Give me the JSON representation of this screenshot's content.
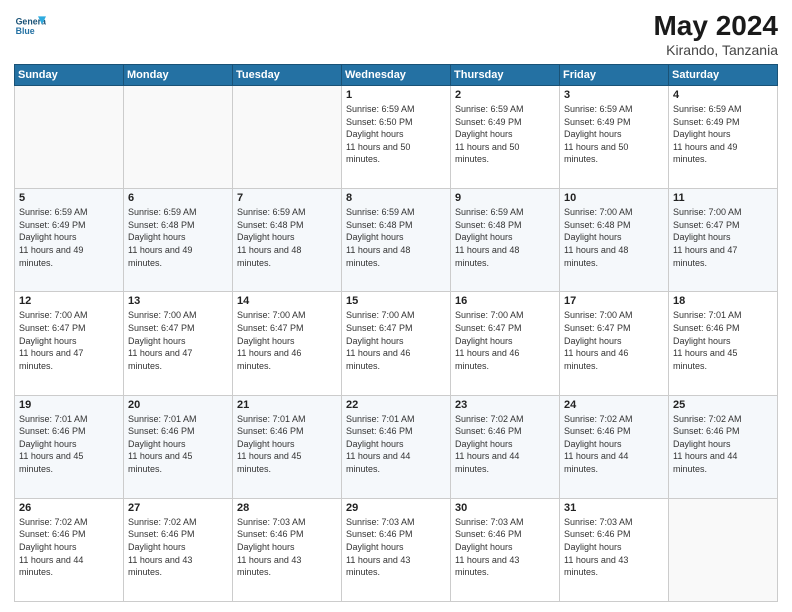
{
  "header": {
    "logo_line1": "General",
    "logo_line2": "Blue",
    "month": "May 2024",
    "location": "Kirando, Tanzania"
  },
  "weekdays": [
    "Sunday",
    "Monday",
    "Tuesday",
    "Wednesday",
    "Thursday",
    "Friday",
    "Saturday"
  ],
  "weeks": [
    [
      {
        "day": "",
        "sunrise": "",
        "sunset": "",
        "daylight": ""
      },
      {
        "day": "",
        "sunrise": "",
        "sunset": "",
        "daylight": ""
      },
      {
        "day": "",
        "sunrise": "",
        "sunset": "",
        "daylight": ""
      },
      {
        "day": "1",
        "sunrise": "6:59 AM",
        "sunset": "6:50 PM",
        "daylight": "11 hours and 50 minutes."
      },
      {
        "day": "2",
        "sunrise": "6:59 AM",
        "sunset": "6:49 PM",
        "daylight": "11 hours and 50 minutes."
      },
      {
        "day": "3",
        "sunrise": "6:59 AM",
        "sunset": "6:49 PM",
        "daylight": "11 hours and 50 minutes."
      },
      {
        "day": "4",
        "sunrise": "6:59 AM",
        "sunset": "6:49 PM",
        "daylight": "11 hours and 49 minutes."
      }
    ],
    [
      {
        "day": "5",
        "sunrise": "6:59 AM",
        "sunset": "6:49 PM",
        "daylight": "11 hours and 49 minutes."
      },
      {
        "day": "6",
        "sunrise": "6:59 AM",
        "sunset": "6:48 PM",
        "daylight": "11 hours and 49 minutes."
      },
      {
        "day": "7",
        "sunrise": "6:59 AM",
        "sunset": "6:48 PM",
        "daylight": "11 hours and 48 minutes."
      },
      {
        "day": "8",
        "sunrise": "6:59 AM",
        "sunset": "6:48 PM",
        "daylight": "11 hours and 48 minutes."
      },
      {
        "day": "9",
        "sunrise": "6:59 AM",
        "sunset": "6:48 PM",
        "daylight": "11 hours and 48 minutes."
      },
      {
        "day": "10",
        "sunrise": "7:00 AM",
        "sunset": "6:48 PM",
        "daylight": "11 hours and 48 minutes."
      },
      {
        "day": "11",
        "sunrise": "7:00 AM",
        "sunset": "6:47 PM",
        "daylight": "11 hours and 47 minutes."
      }
    ],
    [
      {
        "day": "12",
        "sunrise": "7:00 AM",
        "sunset": "6:47 PM",
        "daylight": "11 hours and 47 minutes."
      },
      {
        "day": "13",
        "sunrise": "7:00 AM",
        "sunset": "6:47 PM",
        "daylight": "11 hours and 47 minutes."
      },
      {
        "day": "14",
        "sunrise": "7:00 AM",
        "sunset": "6:47 PM",
        "daylight": "11 hours and 46 minutes."
      },
      {
        "day": "15",
        "sunrise": "7:00 AM",
        "sunset": "6:47 PM",
        "daylight": "11 hours and 46 minutes."
      },
      {
        "day": "16",
        "sunrise": "7:00 AM",
        "sunset": "6:47 PM",
        "daylight": "11 hours and 46 minutes."
      },
      {
        "day": "17",
        "sunrise": "7:00 AM",
        "sunset": "6:47 PM",
        "daylight": "11 hours and 46 minutes."
      },
      {
        "day": "18",
        "sunrise": "7:01 AM",
        "sunset": "6:46 PM",
        "daylight": "11 hours and 45 minutes."
      }
    ],
    [
      {
        "day": "19",
        "sunrise": "7:01 AM",
        "sunset": "6:46 PM",
        "daylight": "11 hours and 45 minutes."
      },
      {
        "day": "20",
        "sunrise": "7:01 AM",
        "sunset": "6:46 PM",
        "daylight": "11 hours and 45 minutes."
      },
      {
        "day": "21",
        "sunrise": "7:01 AM",
        "sunset": "6:46 PM",
        "daylight": "11 hours and 45 minutes."
      },
      {
        "day": "22",
        "sunrise": "7:01 AM",
        "sunset": "6:46 PM",
        "daylight": "11 hours and 44 minutes."
      },
      {
        "day": "23",
        "sunrise": "7:02 AM",
        "sunset": "6:46 PM",
        "daylight": "11 hours and 44 minutes."
      },
      {
        "day": "24",
        "sunrise": "7:02 AM",
        "sunset": "6:46 PM",
        "daylight": "11 hours and 44 minutes."
      },
      {
        "day": "25",
        "sunrise": "7:02 AM",
        "sunset": "6:46 PM",
        "daylight": "11 hours and 44 minutes."
      }
    ],
    [
      {
        "day": "26",
        "sunrise": "7:02 AM",
        "sunset": "6:46 PM",
        "daylight": "11 hours and 44 minutes."
      },
      {
        "day": "27",
        "sunrise": "7:02 AM",
        "sunset": "6:46 PM",
        "daylight": "11 hours and 43 minutes."
      },
      {
        "day": "28",
        "sunrise": "7:03 AM",
        "sunset": "6:46 PM",
        "daylight": "11 hours and 43 minutes."
      },
      {
        "day": "29",
        "sunrise": "7:03 AM",
        "sunset": "6:46 PM",
        "daylight": "11 hours and 43 minutes."
      },
      {
        "day": "30",
        "sunrise": "7:03 AM",
        "sunset": "6:46 PM",
        "daylight": "11 hours and 43 minutes."
      },
      {
        "day": "31",
        "sunrise": "7:03 AM",
        "sunset": "6:46 PM",
        "daylight": "11 hours and 43 minutes."
      },
      {
        "day": "",
        "sunrise": "",
        "sunset": "",
        "daylight": ""
      }
    ]
  ]
}
